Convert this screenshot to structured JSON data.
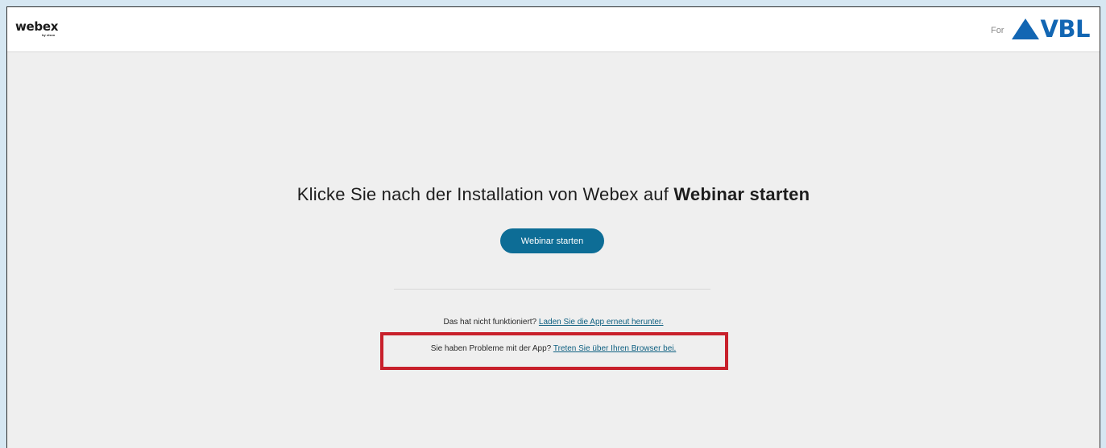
{
  "header": {
    "logo_main": "webex",
    "logo_sub": "by cisco",
    "brand_prefix": "For",
    "brand_name": "VBL",
    "brand_color": "#1266b3"
  },
  "main": {
    "headline_text": "Klicke Sie nach der Installation von Webex auf ",
    "headline_bold": "Webinar starten",
    "start_button": "Webinar starten",
    "retry_text": "Das hat nicht funktioniert? ",
    "retry_link": "Laden Sie die App erneut herunter.",
    "browser_text": "Sie haben Probleme mit der App? ",
    "browser_link": "Treten Sie über Ihren Browser bei."
  },
  "colors": {
    "button_bg": "#0d6d96",
    "link": "#0d5f80",
    "highlight_border": "#c8202b",
    "page_bg": "#efefef"
  }
}
